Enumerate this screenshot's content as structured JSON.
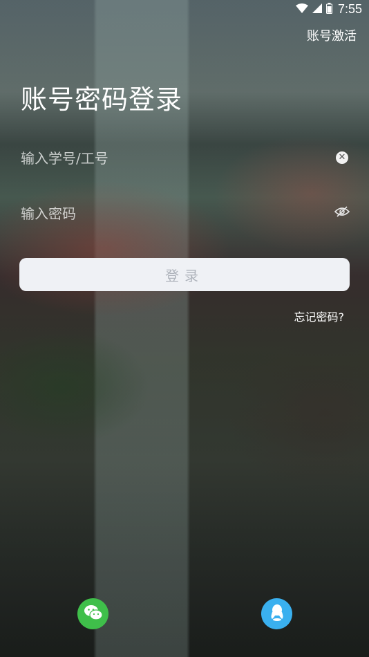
{
  "status_bar": {
    "time": "7:55"
  },
  "header": {
    "activate_link": "账号激活",
    "title": "账号密码登录"
  },
  "form": {
    "username_placeholder": "输入学号/工号",
    "password_placeholder": "输入密码",
    "login_label": "登录",
    "forgot_link": "忘记密码?"
  },
  "social": {
    "wechat_icon": "wechat-icon",
    "qq_icon": "qq-icon"
  },
  "colors": {
    "login_button_bg": "#eff1f5",
    "login_button_text": "#aeb3bb",
    "wechat": "#3fbf4a",
    "qq": "#3ab0ef"
  }
}
